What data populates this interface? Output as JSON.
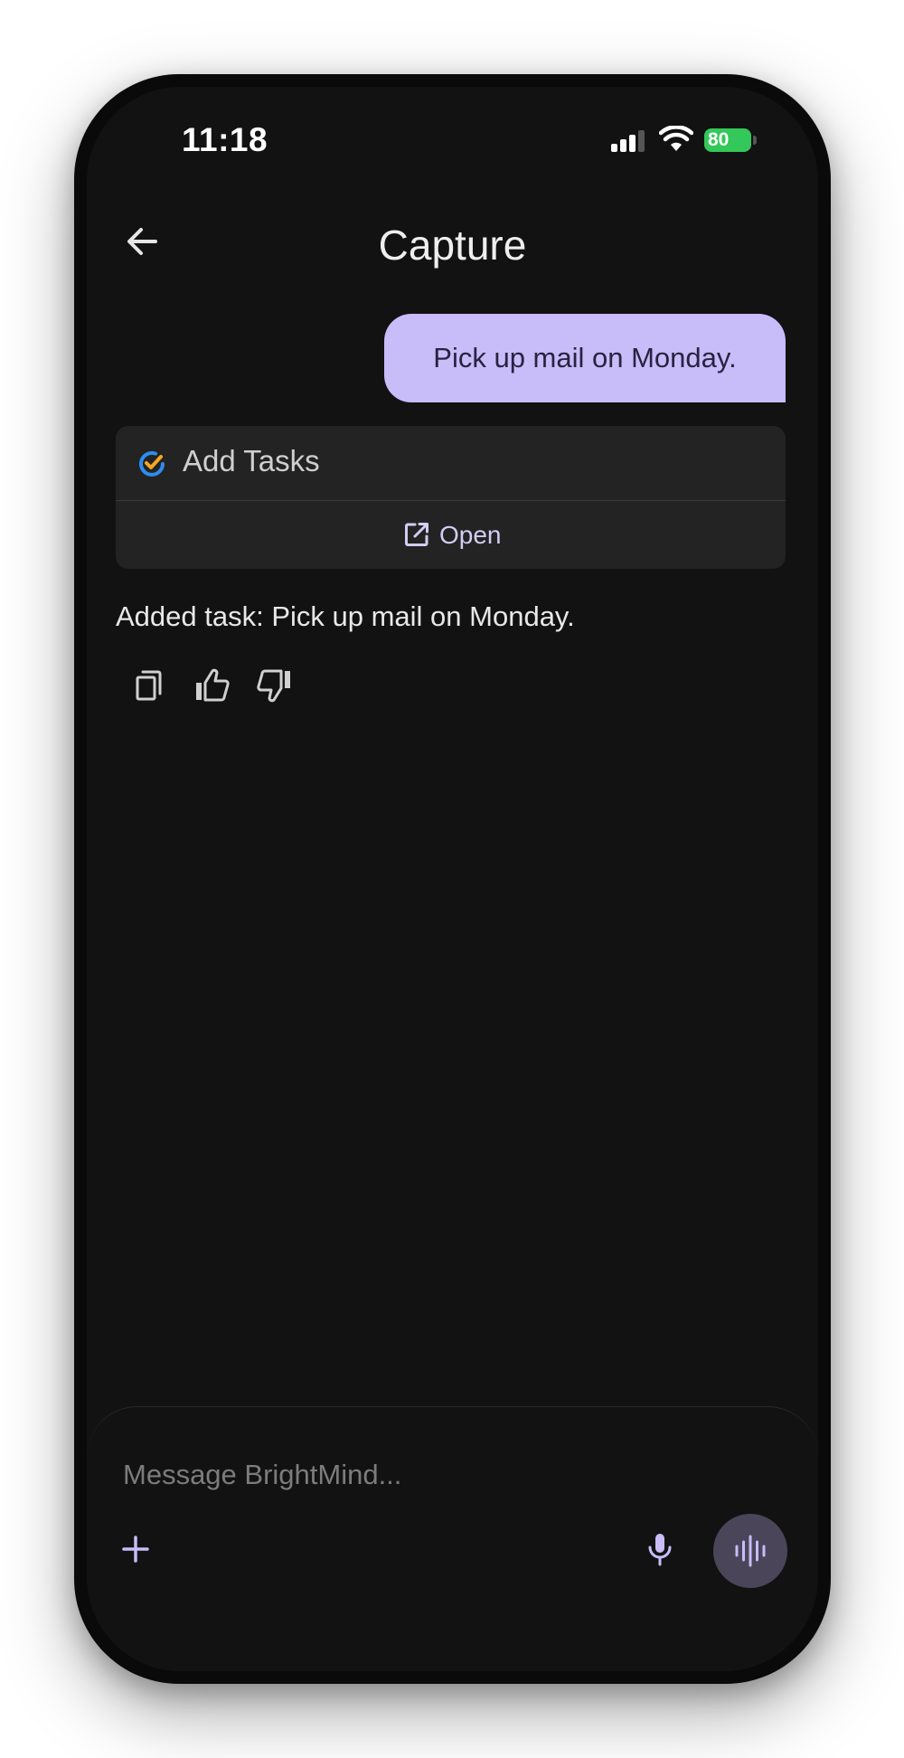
{
  "status_bar": {
    "time": "11:18",
    "battery": "80",
    "icons": [
      "signal-icon",
      "wifi-icon",
      "battery-icon"
    ]
  },
  "header": {
    "title": "Capture",
    "back_icon": "arrow-left-icon"
  },
  "conversation": {
    "user_message": "Pick up mail on Monday.",
    "tool_card": {
      "title": "Add Tasks",
      "icon": "task-check-icon",
      "open_label": "Open",
      "open_icon": "external-link-icon"
    },
    "assistant_message": "Added task: Pick up mail on Monday.",
    "actions": [
      "copy-icon",
      "thumbs-up-icon",
      "thumbs-down-icon"
    ]
  },
  "composer": {
    "placeholder": "Message BrightMind...",
    "value": "",
    "icons": [
      "plus-icon",
      "microphone-icon",
      "voice-waveform-icon"
    ]
  },
  "colors": {
    "background": "#121212",
    "user_bubble": "#c8bcf9",
    "accent": "#c8bcf9",
    "card": "#232323",
    "battery": "#34c759",
    "voice_button": "#4a4558"
  }
}
